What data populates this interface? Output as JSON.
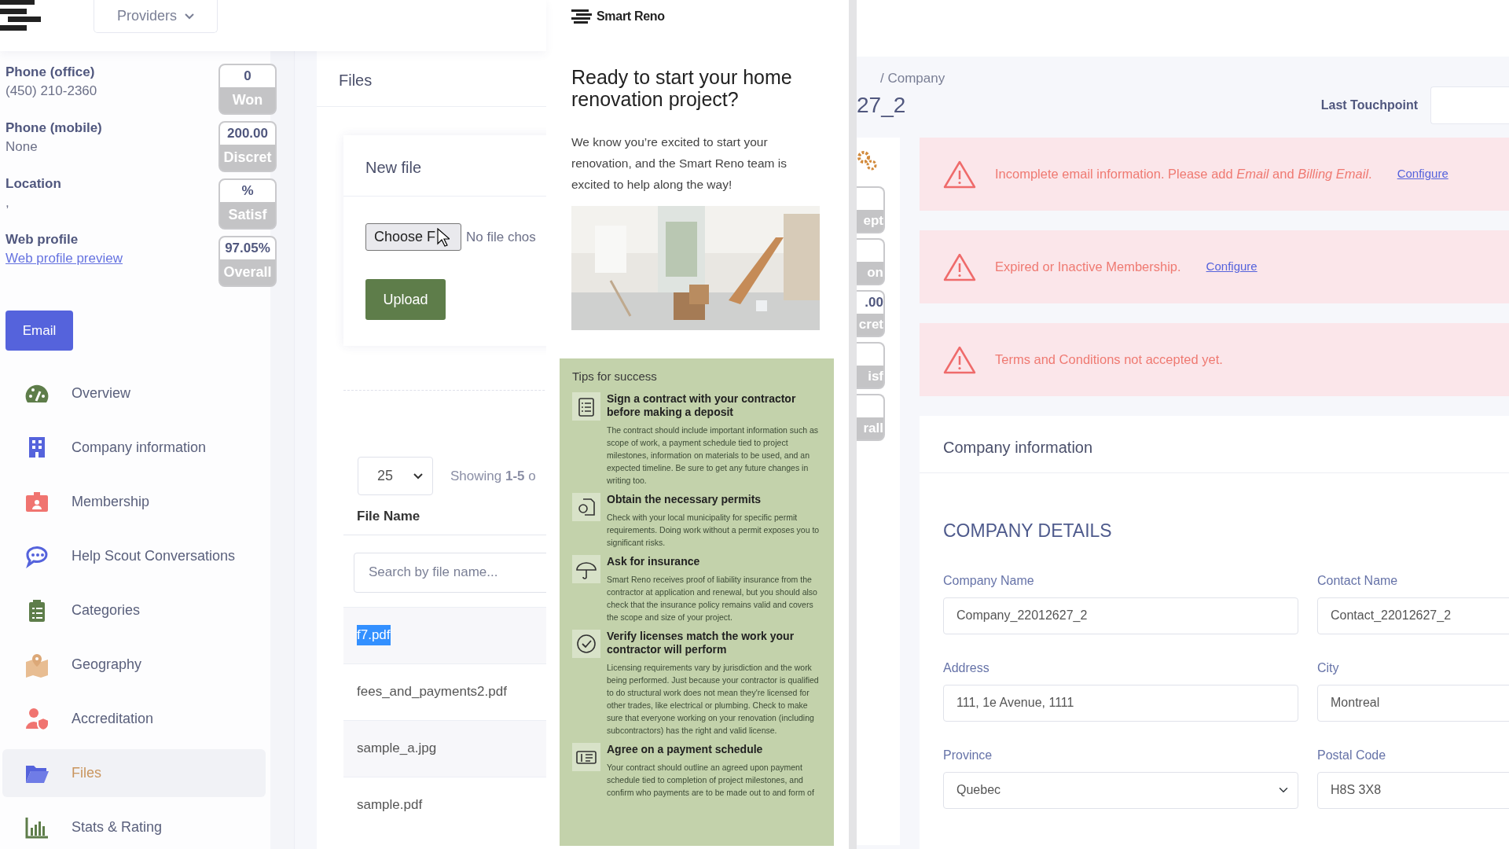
{
  "header": {
    "providers": "Providers"
  },
  "profile_fields": [
    {
      "label": "Phone (office)",
      "value": "(450) 210-2360",
      "kind": "text"
    },
    {
      "label": "Phone (mobile)",
      "value": "None",
      "kind": "text"
    },
    {
      "label": "Location",
      "value": ",",
      "kind": "text"
    },
    {
      "label": "Web profile",
      "value": "Web profile preview",
      "kind": "link"
    }
  ],
  "stat_badges": [
    {
      "value": "0",
      "label": "Won"
    },
    {
      "value": "200.00",
      "label": "Discret"
    },
    {
      "value": "%",
      "label": "Satisf"
    },
    {
      "value": "97.05%",
      "label": "Overall"
    }
  ],
  "email_button": "Email",
  "nav": [
    {
      "label": "Overview",
      "selected": false
    },
    {
      "label": "Company information",
      "selected": false
    },
    {
      "label": "Membership",
      "selected": false
    },
    {
      "label": "Help Scout Conversations",
      "selected": false
    },
    {
      "label": "Categories",
      "selected": false
    },
    {
      "label": "Geography",
      "selected": false
    },
    {
      "label": "Accreditation",
      "selected": false
    },
    {
      "label": "Files",
      "selected": true
    },
    {
      "label": "Stats & Rating",
      "selected": false
    }
  ],
  "files": {
    "title": "Files",
    "new_file_title": "New file",
    "choose_button": "Choose F",
    "no_file": "No file chos",
    "upload_button": "Upload",
    "page_size": "25",
    "showing": "Showing **1-5** o",
    "column": "File Name",
    "search_placeholder": "Search by file name...",
    "rows": [
      {
        "name": "f7.pdf",
        "selected": true
      },
      {
        "name": "fees_and_payments2.pdf",
        "selected": false
      },
      {
        "name": "sample_a.jpg",
        "selected": false
      },
      {
        "name": "sample.pdf",
        "selected": false
      }
    ]
  },
  "flyer": {
    "brand": "Smart Reno",
    "heading": "Ready to start your home renovation project?",
    "intro": "We know you’re excited to start your renovation, and the Smart Reno team is excited to help along the way!",
    "tips_title": "Tips for success",
    "tips": [
      {
        "title": "Sign a contract with your contractor before making a deposit",
        "body": "The contract should include important information such as scope of work, a payment schedule tied to project milestones, information on materials to be used, and an expected timeline. Be sure to get any future changes in writing too."
      },
      {
        "title": "Obtain the necessary permits",
        "body": "Check with your local municipality for specific permit requirements. Doing work without a permit exposes you to significant risks."
      },
      {
        "title": "Ask for insurance",
        "body": "Smart Reno receives proof of liability insurance from the contractor at application and renewal, but you should also check that the insurance policy remains valid and covers the scope and size of your project."
      },
      {
        "title": "Verify licenses match the work your contractor will perform",
        "body": "Licensing requirements vary by jurisdiction and the work being performed. Just because your contractor is qualified to do structural work does not mean they're licensed for other trades, like electrical or plumbing. Check to make sure that everyone working on your renovation (including subcontractors) has the right and valid license."
      },
      {
        "title": "Agree on a payment schedule",
        "body": "Your contract should outline an agreed upon payment schedule tied to completion of project milestones, and confirm who payments are to be made out to and form of"
      }
    ]
  },
  "company": {
    "breadcrumb": "/ Company",
    "title_fragment": "27_2",
    "last_touchpoint": "Last Touchpoint",
    "side_badges": [
      {
        "label": "ept"
      },
      {
        "label": "on"
      },
      {
        "value": ".00",
        "label": "cret"
      },
      {
        "label": "isf"
      },
      {
        "label": "rall"
      }
    ],
    "alerts": [
      {
        "text": "Incomplete email information. Please add *Email* and *Billing Email*.",
        "link": "Configure"
      },
      {
        "text": "Expired or Inactive Membership.",
        "link": "Configure"
      },
      {
        "text": "Terms and Conditions not accepted yet."
      }
    ],
    "card_title": "Company information",
    "section_title": "COMPANY DETAILS",
    "fields": [
      {
        "label": "Company Name",
        "value": "Company_22012627_2",
        "kind": "input"
      },
      {
        "label": "Contact Name",
        "value": "Contact_22012627_2",
        "kind": "input"
      },
      {
        "label": "Address",
        "value": "111, 1e Avenue, 1111",
        "kind": "input"
      },
      {
        "label": "City",
        "value": "Montreal",
        "kind": "input"
      },
      {
        "label": "Province",
        "value": "Quebec",
        "kind": "select"
      },
      {
        "label": "Postal Code",
        "value": "H8S 3X8",
        "kind": "input"
      }
    ]
  }
}
